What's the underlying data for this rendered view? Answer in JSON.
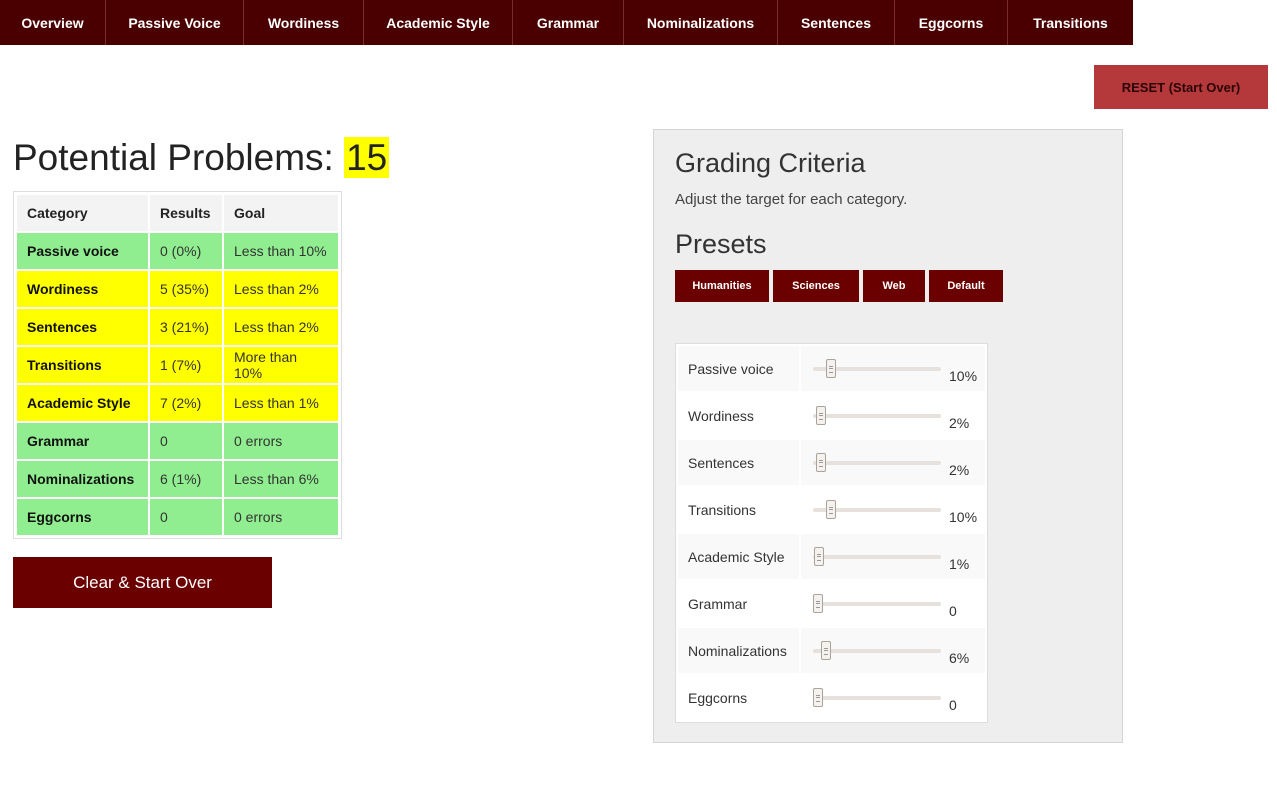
{
  "nav": {
    "tabs": [
      {
        "label": "Overview"
      },
      {
        "label": "Passive Voice"
      },
      {
        "label": "Wordiness"
      },
      {
        "label": "Academic Style"
      },
      {
        "label": "Grammar"
      },
      {
        "label": "Nominalizations"
      },
      {
        "label": "Sentences"
      },
      {
        "label": "Eggcorns"
      },
      {
        "label": "Transitions"
      }
    ]
  },
  "reset_label": "RESET (Start Over)",
  "problems": {
    "title": "Potential Problems:",
    "count": "15"
  },
  "results_table": {
    "headers": [
      "Category",
      "Results",
      "Goal"
    ],
    "rows": [
      {
        "category": "Passive voice",
        "result": "0 (0%)",
        "goal": "Less than 10%",
        "status": "green"
      },
      {
        "category": "Wordiness",
        "result": "5 (35%)",
        "goal": "Less than 2%",
        "status": "yellow"
      },
      {
        "category": "Sentences",
        "result": "3 (21%)",
        "goal": "Less than 2%",
        "status": "yellow"
      },
      {
        "category": "Transitions",
        "result": "1 (7%)",
        "goal": "More than 10%",
        "status": "yellow"
      },
      {
        "category": "Academic Style",
        "result": "7 (2%)",
        "goal": "Less than 1%",
        "status": "yellow"
      },
      {
        "category": "Grammar",
        "result": "0",
        "goal": "0 errors",
        "status": "green"
      },
      {
        "category": "Nominalizations",
        "result": "6 (1%)",
        "goal": "Less than 6%",
        "status": "green"
      },
      {
        "category": "Eggcorns",
        "result": "0",
        "goal": "0 errors",
        "status": "green"
      }
    ]
  },
  "clear_label": "Clear & Start Over",
  "grading": {
    "title": "Grading Criteria",
    "subtitle": "Adjust the target for each category.",
    "presets_title": "Presets",
    "presets": [
      "Humanities",
      "Sciences",
      "Web",
      "Default"
    ],
    "criteria": [
      {
        "label": "Passive voice",
        "value": "10%",
        "level": 0.1
      },
      {
        "label": "Wordiness",
        "value": "2%",
        "level": 0.02
      },
      {
        "label": "Sentences",
        "value": "2%",
        "level": 0.02
      },
      {
        "label": "Transitions",
        "value": "10%",
        "level": 0.1
      },
      {
        "label": "Academic Style",
        "value": "1%",
        "level": 0.01
      },
      {
        "label": "Grammar",
        "value": "0",
        "level": 0
      },
      {
        "label": "Nominalizations",
        "value": "6%",
        "level": 0.06
      },
      {
        "label": "Eggcorns",
        "value": "0",
        "level": 0
      }
    ]
  },
  "colors": {
    "nav_bg": "#4a0000",
    "button_dark_red": "#6b0000",
    "reset_red": "#b5393b",
    "status_green": "#90ee90",
    "status_yellow": "#ffff00"
  }
}
